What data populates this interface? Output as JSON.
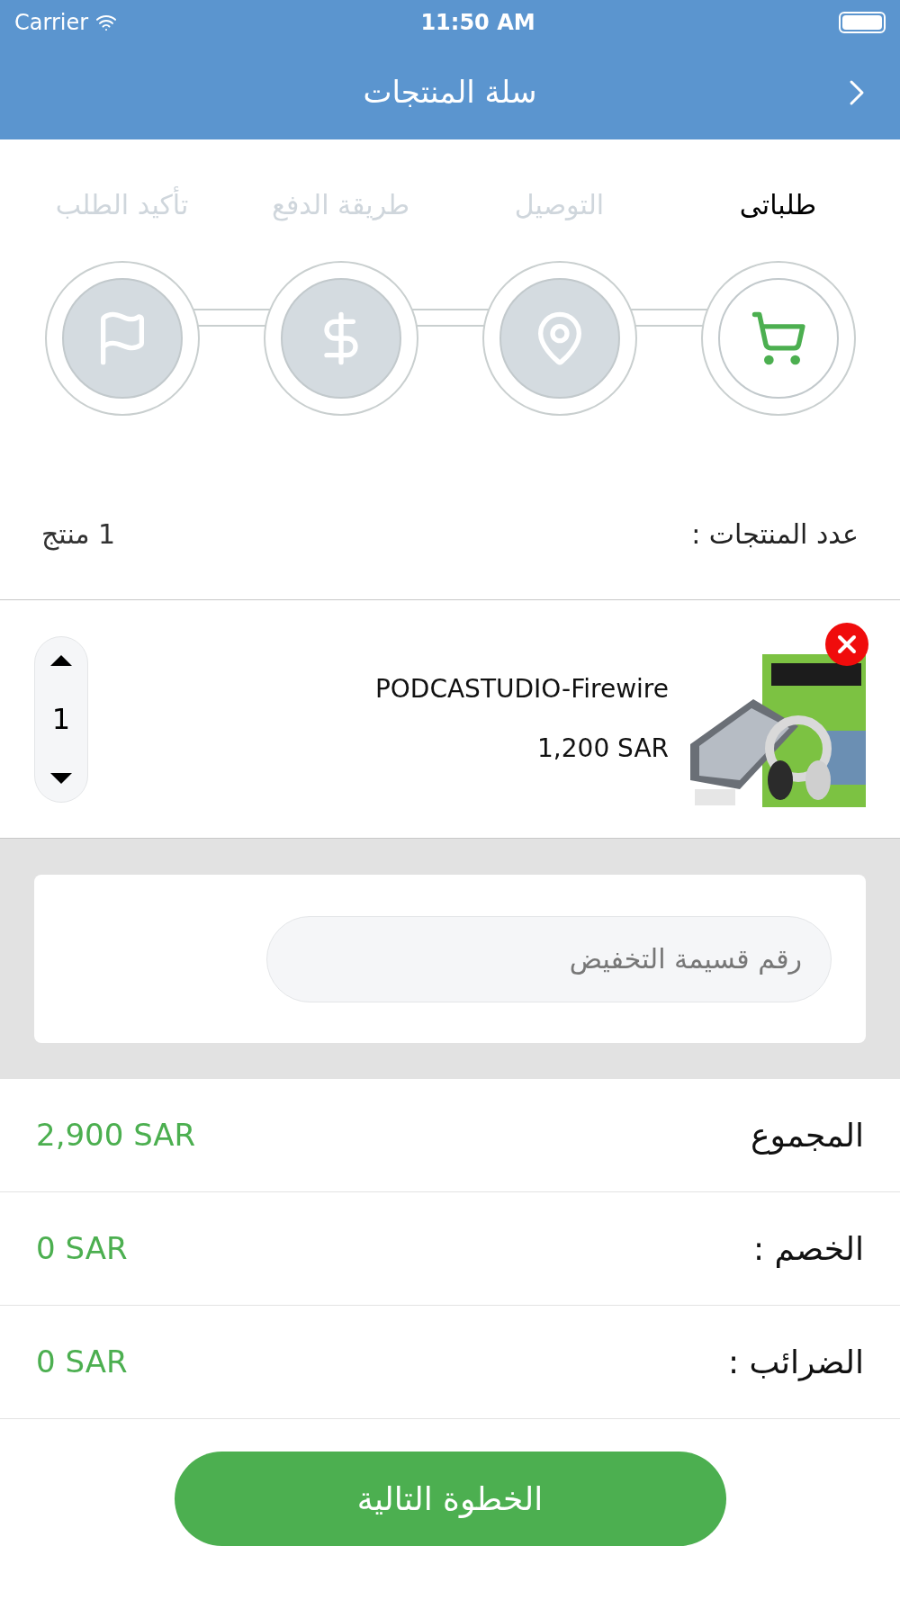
{
  "status_bar": {
    "carrier": "Carrier",
    "time": "11:50 AM"
  },
  "header": {
    "title": "سلة المنتجات"
  },
  "steps": [
    {
      "label": "طلباتى",
      "kind": "cart",
      "selected": true
    },
    {
      "label": "التوصيل",
      "kind": "location",
      "selected": false
    },
    {
      "label": "طريقة الدفع",
      "kind": "payment",
      "selected": false
    },
    {
      "label": "تأكيد الطلب",
      "kind": "confirm",
      "selected": false
    }
  ],
  "count": {
    "label": "عدد المنتجات :",
    "value": "1 منتج"
  },
  "products": [
    {
      "name": "PODCASTUDIO-Firewire",
      "price": "1,200 SAR",
      "quantity": "1"
    }
  ],
  "coupon": {
    "placeholder": "رقم قسيمة التخفيض"
  },
  "totals": [
    {
      "label": "المجموع",
      "value": "2,900 SAR"
    },
    {
      "label": "الخصم :",
      "value": "0 SAR"
    },
    {
      "label": "الضرائب :",
      "value": "0 SAR"
    }
  ],
  "next_button": "الخطوة التالية"
}
